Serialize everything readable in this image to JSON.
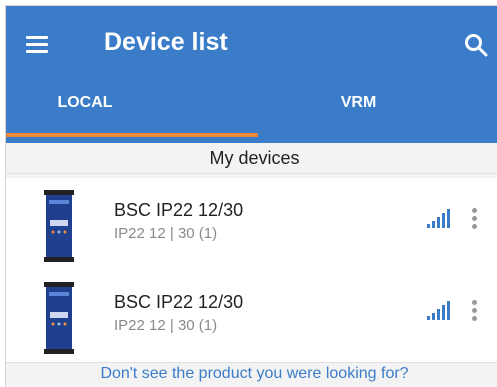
{
  "header": {
    "title": "Device list"
  },
  "tabs": [
    {
      "label": "LOCAL",
      "active": true
    },
    {
      "label": "VRM",
      "active": false
    }
  ],
  "section": {
    "title": "My devices"
  },
  "devices": [
    {
      "name": "BSC IP22 12/30",
      "details": "IP22 12 | 30 (1)"
    },
    {
      "name": "BSC IP22 12/30",
      "details": "IP22 12 | 30 (1)"
    }
  ],
  "footer": {
    "link": "Don't see the product you were looking for?"
  },
  "icons": {
    "menu": "menu-icon",
    "search": "search-icon",
    "signal": "signal-strength-icon",
    "more": "more-vert-icon",
    "device": "charger-device-icon"
  },
  "colors": {
    "primary": "#3a7cc8",
    "accent": "#f08a3a"
  }
}
